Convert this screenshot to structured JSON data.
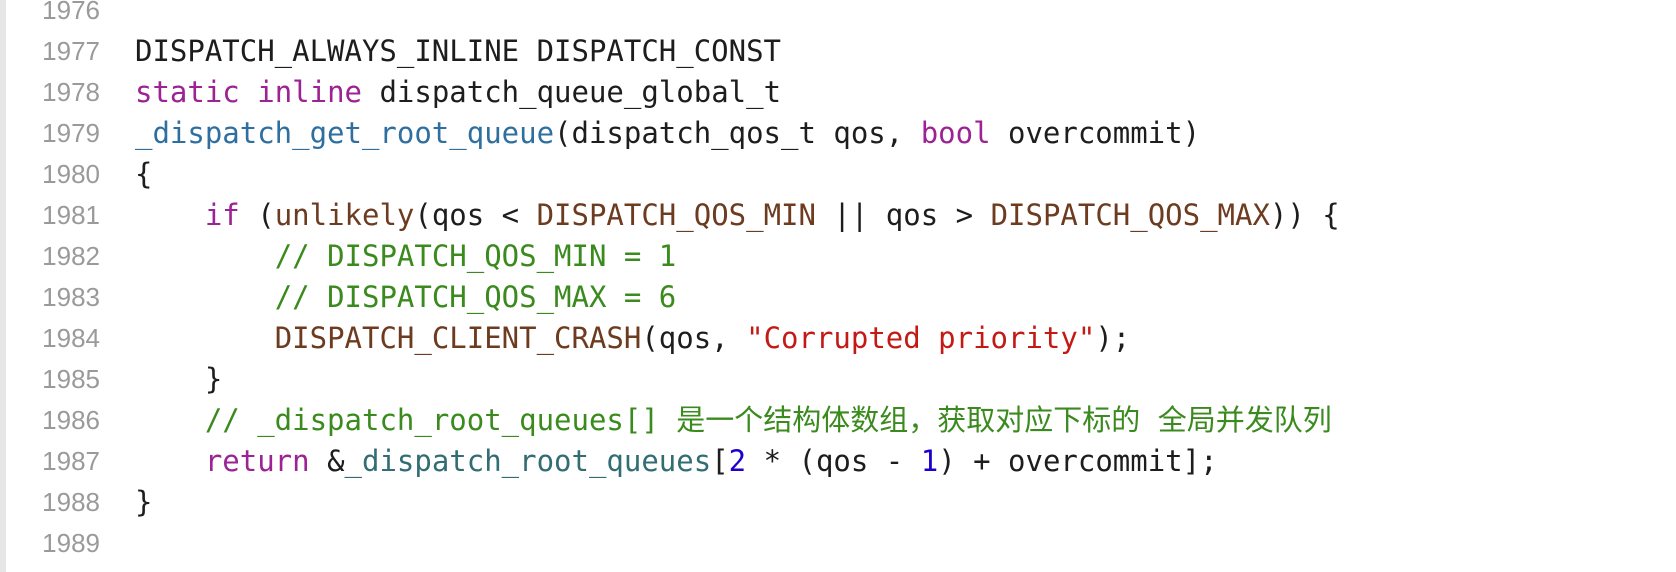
{
  "editor": {
    "lines": [
      {
        "num": "1976",
        "tokens": []
      },
      {
        "num": "1977",
        "tokens": [
          {
            "t": "DISPATCH_ALWAYS_INLINE DISPATCH_CONST",
            "c": "plain"
          }
        ]
      },
      {
        "num": "1978",
        "tokens": [
          {
            "t": "static",
            "c": "kw"
          },
          {
            "t": " ",
            "c": "plain"
          },
          {
            "t": "inline",
            "c": "kw"
          },
          {
            "t": " dispatch_queue_global_t",
            "c": "plain"
          }
        ]
      },
      {
        "num": "1979",
        "tokens": [
          {
            "t": "_dispatch_get_root_queue",
            "c": "fn2"
          },
          {
            "t": "(dispatch_qos_t qos, ",
            "c": "plain"
          },
          {
            "t": "bool",
            "c": "kw"
          },
          {
            "t": " overcommit)",
            "c": "plain"
          }
        ]
      },
      {
        "num": "1980",
        "tokens": [
          {
            "t": "{",
            "c": "plain"
          }
        ]
      },
      {
        "num": "1981",
        "tokens": [
          {
            "t": "    ",
            "c": "plain"
          },
          {
            "t": "if",
            "c": "kw"
          },
          {
            "t": " (",
            "c": "plain"
          },
          {
            "t": "unlikely",
            "c": "mac"
          },
          {
            "t": "(qos < ",
            "c": "plain"
          },
          {
            "t": "DISPATCH_QOS_MIN",
            "c": "mac"
          },
          {
            "t": " || qos > ",
            "c": "plain"
          },
          {
            "t": "DISPATCH_QOS_MAX",
            "c": "mac"
          },
          {
            "t": ")) {",
            "c": "plain"
          }
        ]
      },
      {
        "num": "1982",
        "tokens": [
          {
            "t": "        ",
            "c": "plain"
          },
          {
            "t": "// DISPATCH_QOS_MIN = 1",
            "c": "cm"
          }
        ]
      },
      {
        "num": "1983",
        "tokens": [
          {
            "t": "        ",
            "c": "plain"
          },
          {
            "t": "// DISPATCH_QOS_MAX = 6",
            "c": "cm"
          }
        ]
      },
      {
        "num": "1984",
        "tokens": [
          {
            "t": "        ",
            "c": "plain"
          },
          {
            "t": "DISPATCH_CLIENT_CRASH",
            "c": "mac"
          },
          {
            "t": "(qos, ",
            "c": "plain"
          },
          {
            "t": "\"Corrupted priority\"",
            "c": "str"
          },
          {
            "t": ");",
            "c": "plain"
          }
        ]
      },
      {
        "num": "1985",
        "tokens": [
          {
            "t": "    }",
            "c": "plain"
          }
        ]
      },
      {
        "num": "1986",
        "tokens": [
          {
            "t": "    ",
            "c": "plain"
          },
          {
            "t": "// _dispatch_root_queues[] 是一个结构体数组，获取对应下标的 全局并发队列",
            "c": "cm"
          }
        ]
      },
      {
        "num": "1987",
        "tokens": [
          {
            "t": "    ",
            "c": "plain"
          },
          {
            "t": "return",
            "c": "kw"
          },
          {
            "t": " &",
            "c": "plain"
          },
          {
            "t": "_dispatch_root_queues",
            "c": "fn"
          },
          {
            "t": "[",
            "c": "plain"
          },
          {
            "t": "2",
            "c": "num"
          },
          {
            "t": " * (qos - ",
            "c": "plain"
          },
          {
            "t": "1",
            "c": "num"
          },
          {
            "t": ") + overcommit];",
            "c": "plain"
          }
        ]
      },
      {
        "num": "1988",
        "tokens": [
          {
            "t": "}",
            "c": "plain"
          }
        ]
      },
      {
        "num": "1989",
        "tokens": []
      }
    ]
  }
}
